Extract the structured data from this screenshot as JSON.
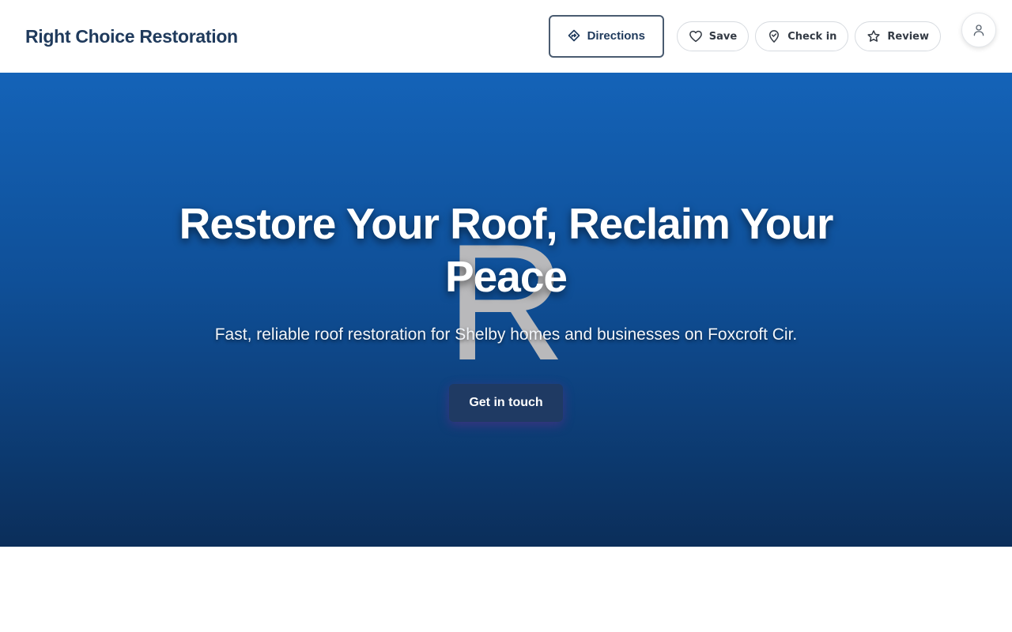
{
  "header": {
    "brand": "Right Choice Restoration",
    "directions_label": "Directions",
    "save_label": "Save",
    "checkin_label": "Check in",
    "review_label": "Review"
  },
  "icons": {
    "directions": "directions-icon",
    "save": "heart-icon",
    "checkin": "map-pin-icon",
    "review": "star-icon",
    "account": "user-icon"
  },
  "hero": {
    "letter": "R",
    "title": "Restore Your Roof, Reclaim Your Peace",
    "subtitle": "Fast, reliable roof restoration for Shelby homes and businesses on Foxcroft Cir.",
    "cta_label": "Get in touch"
  },
  "colors": {
    "brand_text": "#1f3a5c",
    "hero_top": "#1463b8",
    "hero_bottom": "#0b2e5a",
    "cta_bg": "#1f3a63"
  }
}
